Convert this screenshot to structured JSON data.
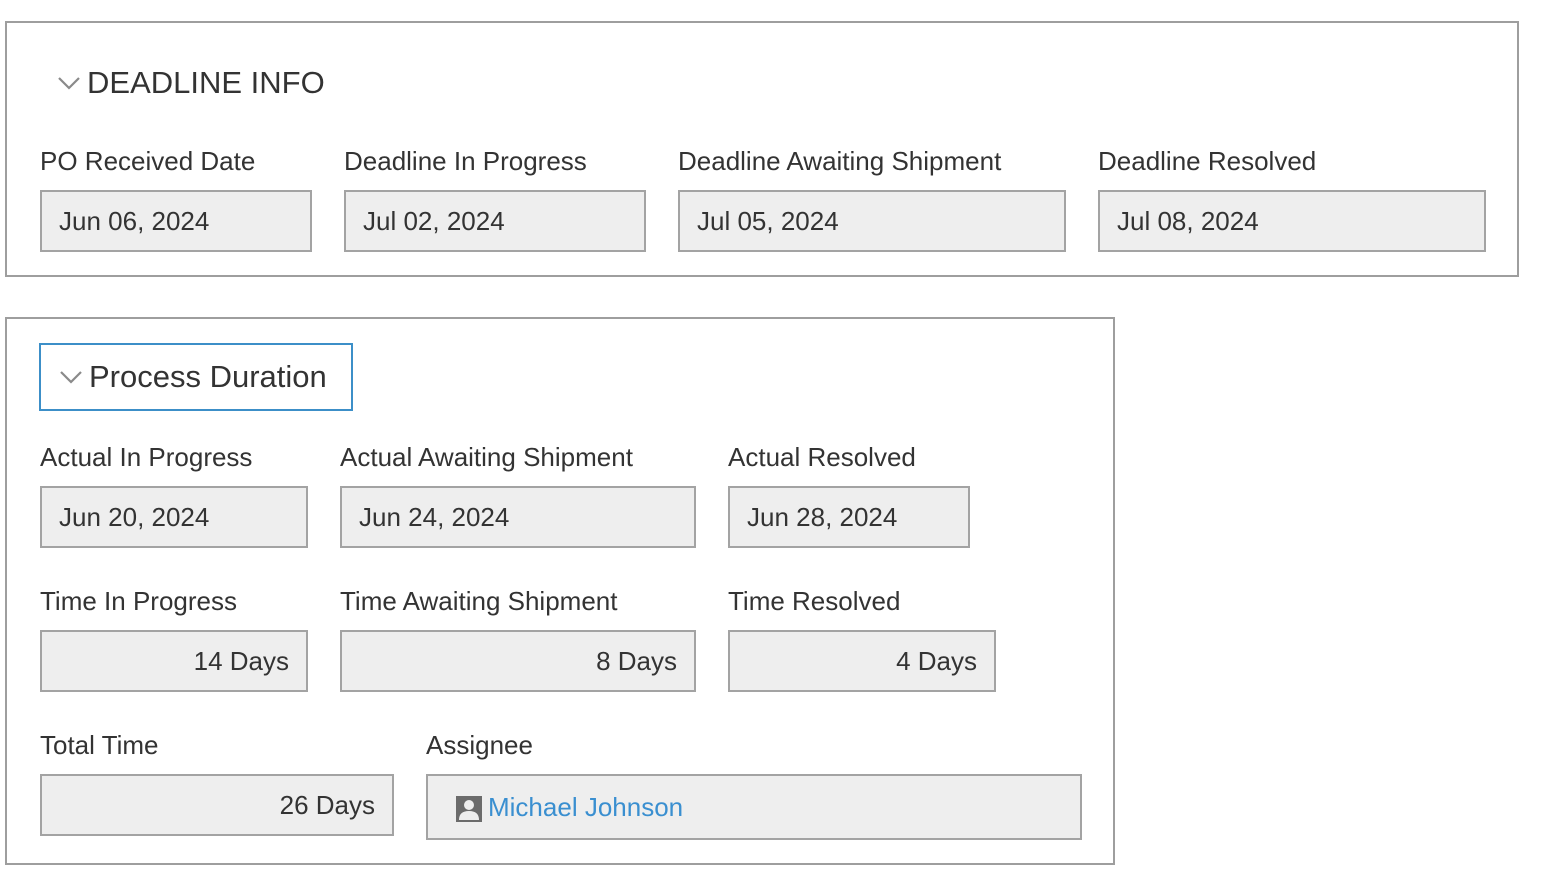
{
  "deadline_info": {
    "title": "DEADLINE INFO",
    "fields": [
      {
        "label": "PO Received Date",
        "value": "Jun 06, 2024"
      },
      {
        "label": "Deadline In Progress",
        "value": "Jul 02, 2024"
      },
      {
        "label": "Deadline Awaiting Shipment",
        "value": "Jul 05, 2024"
      },
      {
        "label": "Deadline Resolved",
        "value": "Jul 08, 2024"
      }
    ]
  },
  "process_duration": {
    "title": "Process Duration",
    "actual": [
      {
        "label": "Actual In Progress",
        "value": "Jun 20, 2024"
      },
      {
        "label": "Actual Awaiting Shipment",
        "value": "Jun 24, 2024"
      },
      {
        "label": "Actual Resolved",
        "value": "Jun 28, 2024"
      }
    ],
    "time": [
      {
        "label": "Time In Progress",
        "value": "14 Days"
      },
      {
        "label": "Time Awaiting Shipment",
        "value": "8 Days"
      },
      {
        "label": "Time Resolved",
        "value": "4 Days"
      }
    ],
    "total_time": {
      "label": "Total Time",
      "value": "26 Days"
    },
    "assignee": {
      "label": "Assignee",
      "value": "Michael Johnson",
      "icon": "person-icon"
    }
  },
  "colors": {
    "link": "#3a8fd0",
    "focus_border": "#3c8fc8",
    "field_bg": "#eeeeee"
  }
}
